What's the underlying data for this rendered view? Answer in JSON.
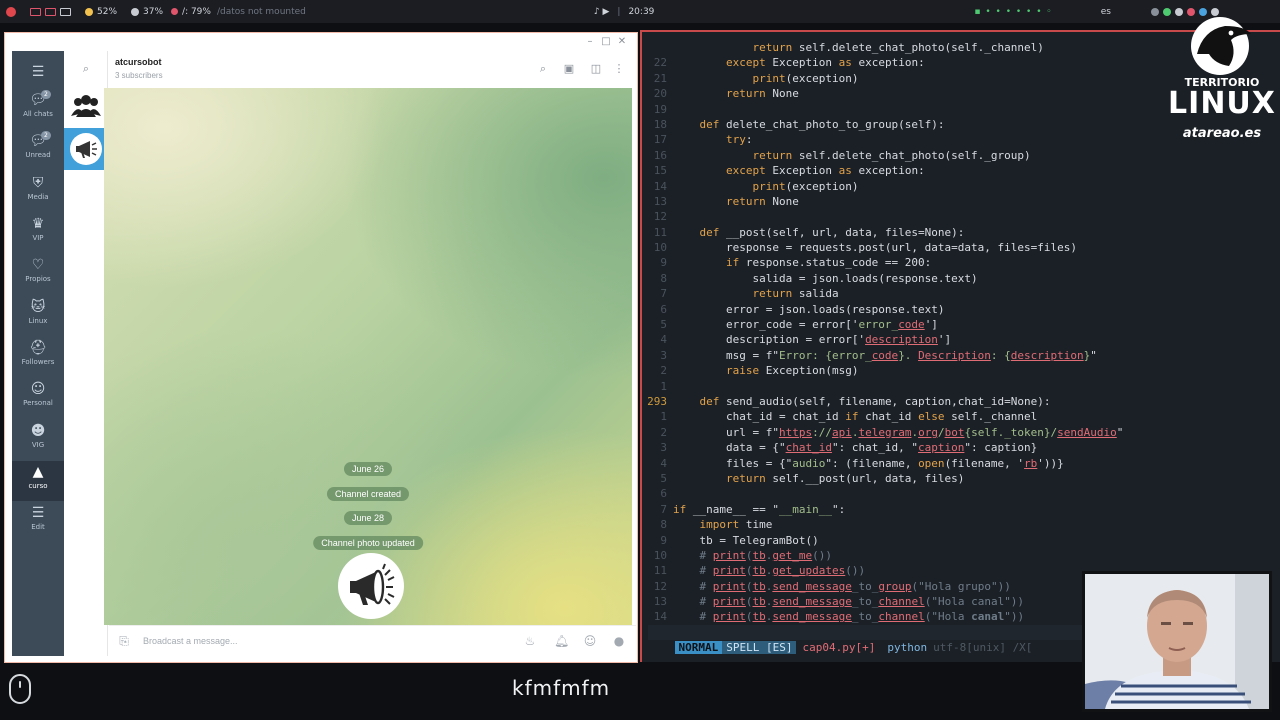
{
  "systembar": {
    "battery1": "52%",
    "battery2": "37%",
    "disk": "/: 79%",
    "datos": "/datos not mounted",
    "time": "20:39",
    "lang": "es"
  },
  "telegram": {
    "folders": [
      {
        "label": "All chats",
        "icon": "chat-bubble-icon",
        "badge": "2"
      },
      {
        "label": "Unread",
        "icon": "chat-bubble-icon",
        "badge": "2"
      },
      {
        "label": "Media",
        "icon": "mask-icon",
        "badge": ""
      },
      {
        "label": "VIP",
        "icon": "crown-icon",
        "badge": ""
      },
      {
        "label": "Propios",
        "icon": "heart-icon",
        "badge": ""
      },
      {
        "label": "Linux",
        "icon": "cat-icon",
        "badge": ""
      },
      {
        "label": "Followers",
        "icon": "helmet-icon",
        "badge": ""
      },
      {
        "label": "Personal",
        "icon": "person-icon",
        "badge": ""
      },
      {
        "label": "VIG",
        "icon": "group-icon",
        "badge": ""
      },
      {
        "label": "curso",
        "icon": "graduation-cap-icon",
        "badge": ""
      },
      {
        "label": "Edit",
        "icon": "sliders-icon",
        "badge": ""
      }
    ],
    "chat": {
      "title": "atcursobot",
      "subtitle": "3 subscribers",
      "service_messages": [
        "June 26",
        "Channel created",
        "June 28",
        "Channel photo updated"
      ],
      "input_placeholder": "Broadcast a message..."
    }
  },
  "editor": {
    "lines": [
      {
        "no": "",
        "indent": 3,
        "html": "<span class=\"kw\">return</span> self.delete_chat_photo(self._channel)"
      },
      {
        "no": "22",
        "indent": 2,
        "html": "<span class=\"kw\">except</span> Exception <span class=\"kw\">as</span> exception:"
      },
      {
        "no": "21",
        "indent": 3,
        "html": "<span class=\"kw\">print</span>(exception)"
      },
      {
        "no": "20",
        "indent": 2,
        "html": "<span class=\"kw\">return</span> None"
      },
      {
        "no": "19",
        "indent": 0,
        "html": ""
      },
      {
        "no": "18",
        "indent": 1,
        "html": "<span class=\"kw\">def</span> delete_chat_photo_to_group(self):"
      },
      {
        "no": "17",
        "indent": 2,
        "html": "<span class=\"kw\">try</span>:"
      },
      {
        "no": "16",
        "indent": 3,
        "html": "<span class=\"kw\">return</span> self.delete_chat_photo(self._group)"
      },
      {
        "no": "15",
        "indent": 2,
        "html": "<span class=\"kw\">except</span> Exception <span class=\"kw\">as</span> exception:"
      },
      {
        "no": "14",
        "indent": 3,
        "html": "<span class=\"kw\">print</span>(exception)"
      },
      {
        "no": "13",
        "indent": 2,
        "html": "<span class=\"kw\">return</span> None"
      },
      {
        "no": "12",
        "indent": 0,
        "html": ""
      },
      {
        "no": "11",
        "indent": 1,
        "html": "<span class=\"kw\">def</span> __post(self, url, data, files=None):"
      },
      {
        "no": "10",
        "indent": 2,
        "html": "response = requests.post(url, data=data, files=files)"
      },
      {
        "no": "9",
        "indent": 2,
        "html": "<span class=\"kw\">if</span> response.status_code == 200:"
      },
      {
        "no": "8",
        "indent": 3,
        "html": "salida = json.loads(response.text)"
      },
      {
        "no": "7",
        "indent": 3,
        "html": "<span class=\"kw\">return</span> salida"
      },
      {
        "no": "6",
        "indent": 2,
        "html": "error = json.loads(response.text)"
      },
      {
        "no": "5",
        "indent": 2,
        "html": "error_code = error['<span class=\"str\">error_</span><span class=\"red\">code</span>']"
      },
      {
        "no": "4",
        "indent": 2,
        "html": "description = error['<span class=\"red\">description</span>']"
      },
      {
        "no": "3",
        "indent": 2,
        "html": "msg = f\"<span class=\"str\">Error: {error_</span><span class=\"red\">code</span><span class=\"str\">}. </span><span class=\"red\">Description</span><span class=\"str\">: {</span><span class=\"red\">description</span><span class=\"str\">}</span>\""
      },
      {
        "no": "2",
        "indent": 2,
        "html": "<span class=\"kw\">raise</span> Exception(msg)"
      },
      {
        "no": "1",
        "indent": 0,
        "html": ""
      },
      {
        "no": "293",
        "indent": 1,
        "cur": true,
        "html": "<span class=\"kw\">def</span> send_audio(self, filename, caption,chat_id=None):"
      },
      {
        "no": "1",
        "indent": 2,
        "html": "chat_id = chat_id <span class=\"kw\">if</span> chat_id <span class=\"kw\">else</span> self._channel"
      },
      {
        "no": "2",
        "indent": 2,
        "html": "url = f\"<span class=\"red\">https</span><span class=\"str\">://</span><span class=\"red\">api</span><span class=\"str\">.</span><span class=\"red\">telegram</span><span class=\"str\">.</span><span class=\"red\">org</span><span class=\"str\">/</span><span class=\"red\">bot</span><span class=\"str\">{self._token}/</span><span class=\"red\">sendAudio</span>\""
      },
      {
        "no": "3",
        "indent": 2,
        "html": "data = {\"<span class=\"red\">chat_id</span>\": chat_id, \"<span class=\"red\">caption</span>\": caption}"
      },
      {
        "no": "4",
        "indent": 2,
        "html": "files = {\"<span class=\"str\">audio</span>\": (filename, <span class=\"kw\">open</span>(filename, '<span class=\"red\">rb</span>'))}"
      },
      {
        "no": "5",
        "indent": 2,
        "html": "<span class=\"kw\">return</span> self.__post(url, data, files)"
      },
      {
        "no": "6",
        "indent": 0,
        "html": ""
      },
      {
        "no": "7",
        "indent": 0,
        "html": "<span class=\"kw\">if</span> __name__ == \"<span class=\"str\">__main__</span>\":"
      },
      {
        "no": "8",
        "indent": 1,
        "html": "<span class=\"kw\">import</span> time"
      },
      {
        "no": "9",
        "indent": 1,
        "html": "tb = TelegramBot()"
      },
      {
        "no": "10",
        "indent": 1,
        "html": "<span class=\"cmt\"># <span class=\"red\">print</span>(<span class=\"red\">tb</span>.<span class=\"red\">get_me</span>())</span>"
      },
      {
        "no": "11",
        "indent": 1,
        "html": "<span class=\"cmt\"># <span class=\"red\">print</span>(<span class=\"red\">tb</span>.<span class=\"red\">get_updates</span>())</span>"
      },
      {
        "no": "12",
        "indent": 1,
        "html": "<span class=\"cmt\"># <span class=\"red\">print</span>(<span class=\"red\">tb</span>.<span class=\"red\">send_message</span>_to_<span class=\"red\">group</span>(\"Hola grupo\"))</span>"
      },
      {
        "no": "13",
        "indent": 1,
        "html": "<span class=\"cmt\"># <span class=\"red\">print</span>(<span class=\"red\">tb</span>.<span class=\"red\">send_message</span>_to_<span class=\"red\">channel</span>(\"Hola canal\"))</span>"
      },
      {
        "no": "14",
        "indent": 1,
        "html": "<span class=\"cmt\"># <span class=\"red\">print</span>(<span class=\"red\">tb</span>.<span class=\"red\">send_message</span>_to_<span class=\"red\">channel</span>(\"Hola <b>canal</b>\"))</span>"
      }
    ],
    "status": {
      "mode": "NORMAL",
      "spell": "SPELL [ES]",
      "file": "cap04.py[+]",
      "filetype": "python",
      "encoding": "utf-8[unix] /X["
    }
  },
  "logo": {
    "line1": "TERRITORIO",
    "line2": "LINUX",
    "line3": "atareao.es"
  },
  "keystrokes": "kfmfmfm"
}
